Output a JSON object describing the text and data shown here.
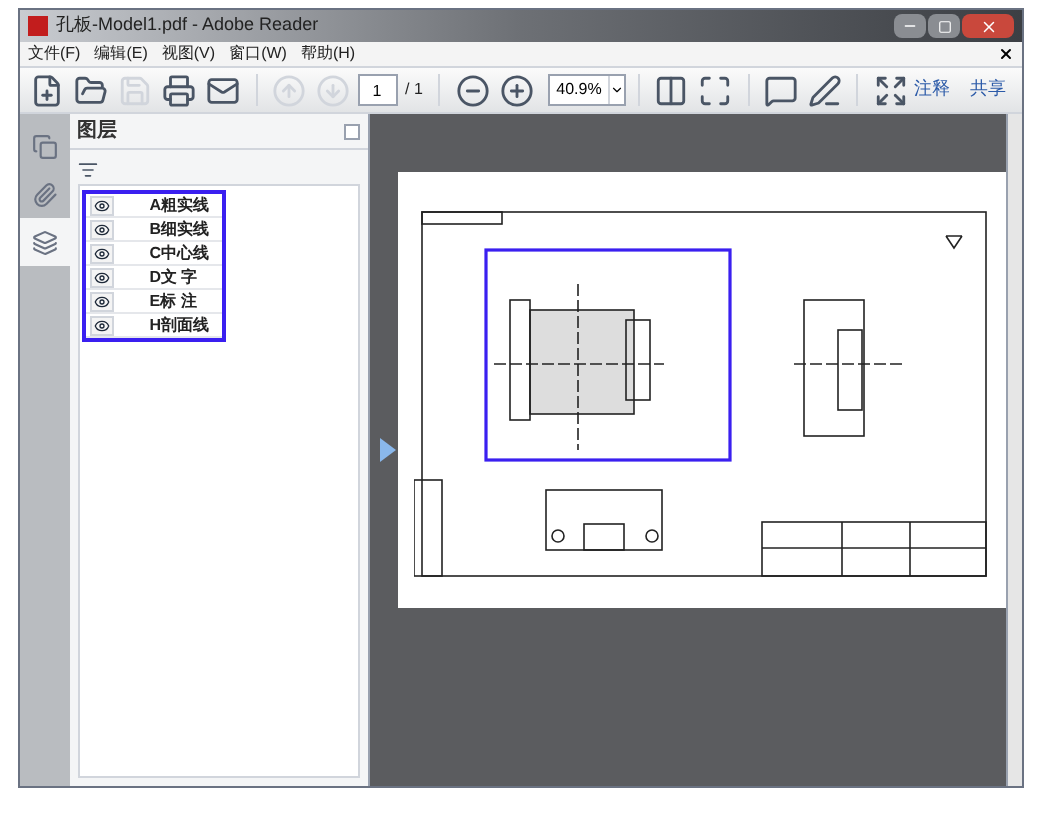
{
  "window": {
    "title": "孔板-Model1.pdf - Adobe Reader"
  },
  "menu": [
    "文件(F)",
    "编辑(E)",
    "视图(V)",
    "窗口(W)",
    "帮助(H)"
  ],
  "toolbar": {
    "page_number": "1",
    "page_total": "/ 1",
    "zoom": "40.9%",
    "buttons": [
      "注释",
      "共享"
    ]
  },
  "nav_tabs": [
    {
      "kind": "pages",
      "selected": false
    },
    {
      "kind": "attachments",
      "selected": false
    },
    {
      "kind": "layers",
      "selected": true
    }
  ],
  "panel": {
    "title": "图层"
  },
  "layers": [
    {
      "name": "A粗实线",
      "visible": true
    },
    {
      "name": "B细实线",
      "visible": true
    },
    {
      "name": "C中心线",
      "visible": true
    },
    {
      "name": "D文 字",
      "visible": true
    },
    {
      "name": "E标 注",
      "visible": true
    },
    {
      "name": "H剖面线",
      "visible": true
    }
  ]
}
